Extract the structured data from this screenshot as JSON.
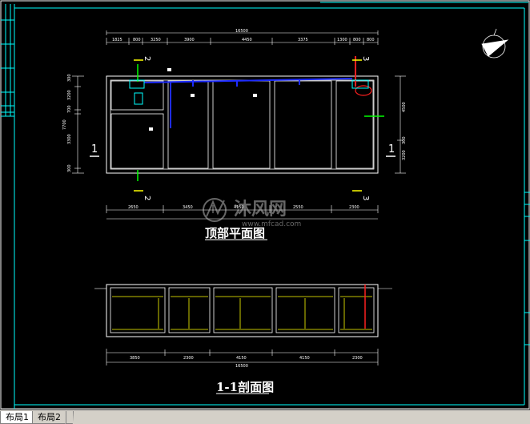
{
  "drawing": {
    "plan_title": "顶部平面图",
    "section_title": "1-1剖面图",
    "dim_top": [
      "1825",
      "800",
      "3250",
      "3900",
      "4450",
      "3375",
      "1300",
      "800",
      "800"
    ],
    "dim_overall": "16500",
    "dim_bottom_plan": [
      "2650",
      "3450",
      "4150",
      "2550",
      "2300"
    ],
    "dim_section": [
      "3850",
      "2300",
      "4150",
      "4150",
      "2300"
    ],
    "dim_section_overall": "16500",
    "dim_left": [
      "300",
      "3200",
      "700",
      "3300",
      "300"
    ],
    "dim_left_overall": "7700",
    "dim_right": [
      "4500",
      "300",
      "3200"
    ],
    "section_marks": {
      "left": "1",
      "right": "1",
      "top_left": "2",
      "bottom_left": "2",
      "top_right": "3",
      "bottom_right": "3"
    }
  },
  "watermark": {
    "cn": "沐风网",
    "url": "www.mfcad.com"
  },
  "layout_tabs": {
    "tab1": "布局1",
    "tab2": "布局2"
  },
  "colors": {
    "bg": "#000000",
    "line": "#ffffff",
    "accent_cyan": "#00ffff",
    "accent_blue": "#1e2cff",
    "accent_red": "#ff2020",
    "accent_green": "#00ff00",
    "accent_yellow": "#ffff00"
  }
}
